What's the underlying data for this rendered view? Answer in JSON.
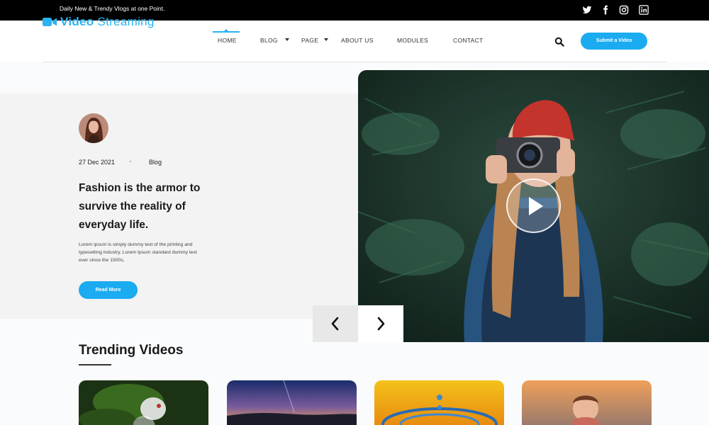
{
  "topbar": {
    "tagline": "Daily New & Trendy Vlogs at one Point.",
    "social_icons": [
      "twitter-icon",
      "facebook-icon",
      "instagram-icon",
      "linkedin-icon"
    ]
  },
  "header": {
    "logo_bold": "Video",
    "logo_light": " Streaming",
    "logo_icon": "video-camera-icon",
    "nav": {
      "home": "HOME",
      "blog": "BLOG",
      "page": "PAGE",
      "about": "ABOUT US",
      "modules": "MODULES",
      "contact": "CONTACT"
    },
    "active_nav": "home",
    "search_icon": "search-icon",
    "submit_label": "Submit a Video"
  },
  "hero": {
    "date": "27 Dec 2021",
    "category": "Blog",
    "title": "Fashion is the armor to survive the reality of everyday life.",
    "body": "Lorem ipsum is simply dummy text of the printing and typesetting industry. Lorem Ipsum standard dummy text ever since the 1500s,",
    "read_more": "Read More",
    "play_icon": "play-icon",
    "prev_icon": "chevron-left-icon",
    "next_icon": "chevron-right-icon"
  },
  "trending": {
    "title": "Trending Videos"
  },
  "colors": {
    "accent": "#1aabf0",
    "topbar": "#000000"
  }
}
